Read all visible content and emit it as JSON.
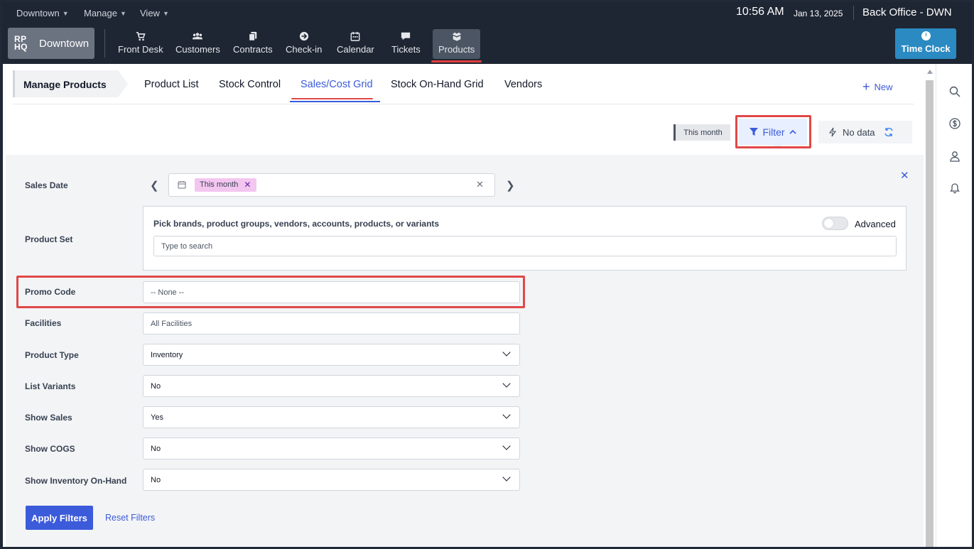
{
  "menubar": {
    "menus": [
      {
        "label": "Downtown"
      },
      {
        "label": "Manage"
      },
      {
        "label": "View"
      }
    ],
    "time": "10:56 AM",
    "date": "Jan 13, 2025",
    "office": "Back Office - DWN"
  },
  "brand": {
    "logo": "RP HQ",
    "logo_line1": "RP",
    "logo_line2": "HQ",
    "name": "Downtown"
  },
  "nav": {
    "items": [
      {
        "label": "Front Desk",
        "icon": "cart-icon"
      },
      {
        "label": "Customers",
        "icon": "users-icon"
      },
      {
        "label": "Contracts",
        "icon": "documents-icon"
      },
      {
        "label": "Check-in",
        "icon": "arrow-circle-icon"
      },
      {
        "label": "Calendar",
        "icon": "calendar-icon"
      },
      {
        "label": "Tickets",
        "icon": "chat-bubble-icon"
      },
      {
        "label": "Products",
        "icon": "boxes-icon",
        "active": true
      }
    ],
    "time_clock": "Time Clock"
  },
  "header": {
    "title": "Manage Products",
    "tabs": [
      {
        "label": "Product List"
      },
      {
        "label": "Stock Control"
      },
      {
        "label": "Sales/Cost Grid",
        "active": true
      },
      {
        "label": "Stock On-Hand Grid"
      },
      {
        "label": "Vendors"
      }
    ],
    "new_label": "New"
  },
  "toolbar": {
    "period_pill": "This month",
    "filter_label": "Filter",
    "nodata_label": "No data"
  },
  "filters": {
    "sales_date": {
      "label": "Sales Date",
      "chip": "This month"
    },
    "product_set": {
      "label": "Product Set",
      "title": "Pick brands, product groups, vendors, accounts, products, or variants",
      "advanced_label": "Advanced",
      "advanced_on": false,
      "search_placeholder": "Type to search"
    },
    "promo_code": {
      "label": "Promo Code",
      "value": "-- None --"
    },
    "facilities": {
      "label": "Facilities",
      "value": "All Facilities"
    },
    "product_type": {
      "label": "Product Type",
      "value": "Inventory"
    },
    "list_variants": {
      "label": "List Variants",
      "value": "No"
    },
    "show_sales": {
      "label": "Show Sales",
      "value": "Yes"
    },
    "show_cogs": {
      "label": "Show COGS",
      "value": "No"
    },
    "show_inventory": {
      "label": "Show Inventory On-Hand",
      "value": "No"
    },
    "apply_label": "Apply Filters",
    "reset_label": "Reset Filters"
  },
  "colors": {
    "accent": "#3b5bdb",
    "highlight": "#e04848",
    "navbar": "#1e2633",
    "time_clock": "#2b8ac2",
    "date_chip": "#f3c6f0"
  }
}
